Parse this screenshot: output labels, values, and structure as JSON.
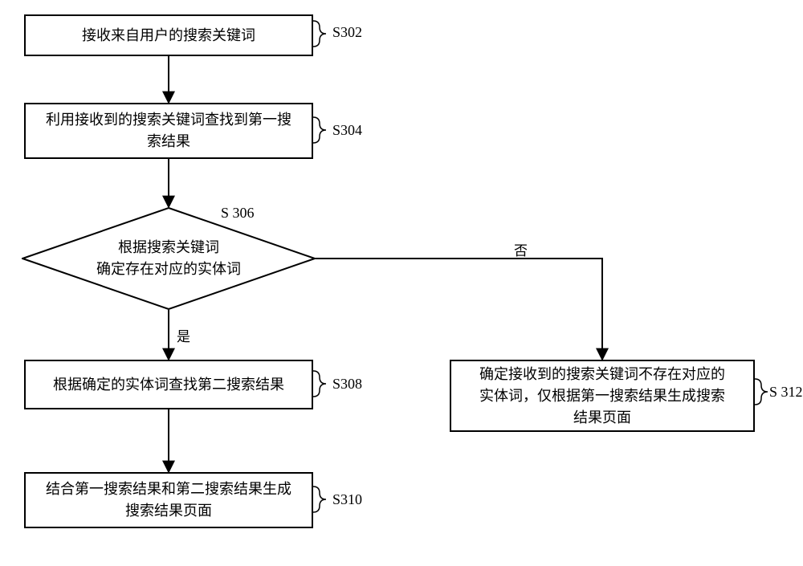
{
  "chart_data": {
    "type": "flowchart",
    "nodes": [
      {
        "id": "s302",
        "shape": "rect",
        "text": "接收来自用户的搜索关键词",
        "label": "S302"
      },
      {
        "id": "s304",
        "shape": "rect",
        "text": "利用接收到的搜索关键词查找到第一搜索结果",
        "label": "S304"
      },
      {
        "id": "s306",
        "shape": "diamond",
        "text": "根据搜索关键词确定存在对应的实体词",
        "label": "S 306"
      },
      {
        "id": "s308",
        "shape": "rect",
        "text": "根据确定的实体词查找第二搜索结果",
        "label": "S308"
      },
      {
        "id": "s310",
        "shape": "rect",
        "text": "结合第一搜索结果和第二搜索结果生成搜索结果页面",
        "label": "S310"
      },
      {
        "id": "s312",
        "shape": "rect",
        "text": "确定接收到的搜索关键词不存在对应的实体词，仅根据第一搜索结果生成搜索结果页面",
        "label": "S 312"
      }
    ],
    "edges": [
      {
        "from": "s302",
        "to": "s304"
      },
      {
        "from": "s304",
        "to": "s306"
      },
      {
        "from": "s306",
        "to": "s308",
        "label": "是"
      },
      {
        "from": "s306",
        "to": "s312",
        "label": "否"
      },
      {
        "from": "s308",
        "to": "s310"
      }
    ]
  },
  "boxes": {
    "s302": {
      "text": "接收来自用户的搜索关键词"
    },
    "s304": {
      "text": "利用接收到的搜索关键词查找到第一搜\n索结果"
    },
    "s306": {
      "text": "根据搜索关键词\n确定存在对应的实体词"
    },
    "s308": {
      "text": "根据确定的实体词查找第二搜索结果"
    },
    "s310": {
      "text": "结合第一搜索结果和第二搜索结果生成\n搜索结果页面"
    },
    "s312": {
      "text": "确定接收到的搜索关键词不存在对应的\n实体词，仅根据第一搜索结果生成搜索\n结果页面"
    }
  },
  "labels": {
    "s302": "S302",
    "s304": "S304",
    "s306": "S 306",
    "s308": "S308",
    "s310": "S310",
    "s312": "S 312"
  },
  "edge_labels": {
    "yes": "是",
    "no": "否"
  }
}
